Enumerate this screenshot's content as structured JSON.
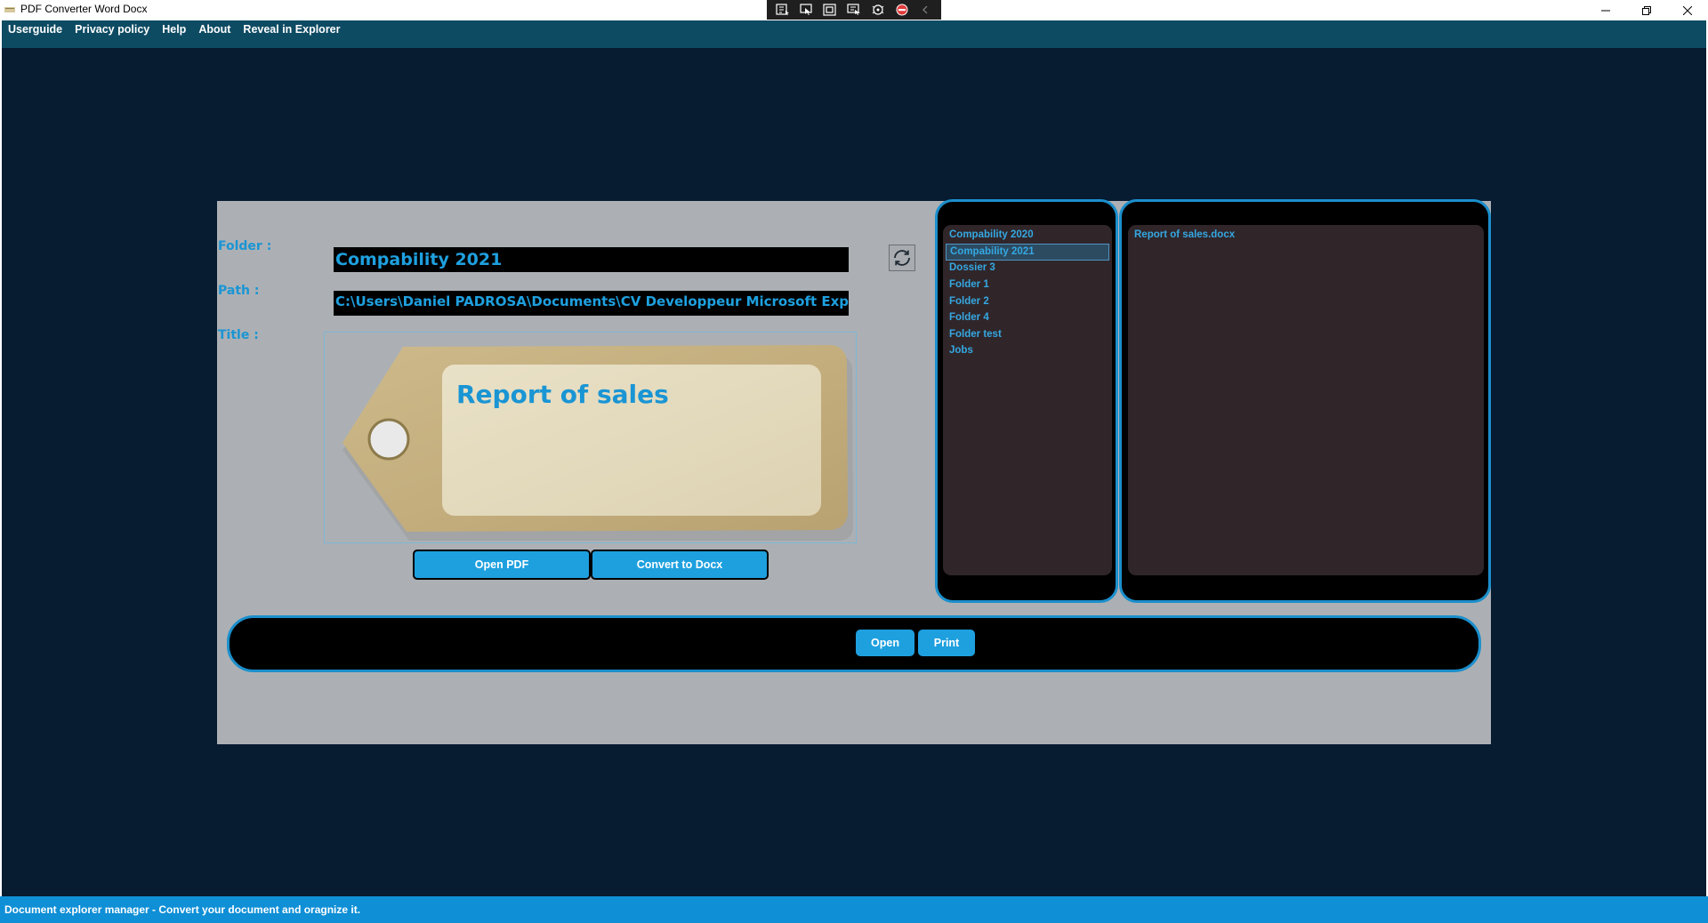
{
  "window": {
    "title": "PDF Converter Word Docx"
  },
  "debug_toolbar": {
    "icons": [
      "live-visual-tree-icon",
      "select-element-icon",
      "display-adorners-icon",
      "track-focus-icon",
      "hot-reload-icon",
      "stop-icon",
      "collapse-icon"
    ]
  },
  "menu": {
    "items": [
      "Userguide",
      "Privacy policy",
      "Help",
      "About",
      "Reveal in Explorer"
    ]
  },
  "form": {
    "folder_label": "Folder :",
    "path_label": "Path :",
    "title_label": "Title :",
    "folder_value": "Compability 2021",
    "path_value": "C:\\Users\\Daniel PADROSA\\Documents\\CV Developpeur Microsoft Experiment",
    "title_value": "Report of sales",
    "refresh_icon": "refresh-icon"
  },
  "buttons": {
    "open_pdf": "Open PDF",
    "convert_docx": "Convert to Docx",
    "open": "Open",
    "print": "Print"
  },
  "folders": {
    "items": [
      "Compability 2020",
      "Compability 2021",
      "Dossier 3",
      "Folder 1",
      "Folder 2",
      "Folder 4",
      "Folder test",
      "Jobs"
    ],
    "selected": "Compability 2021"
  },
  "files": {
    "items": [
      "Report of sales.docx"
    ]
  },
  "status": {
    "text": "Document explorer manager - Convert your document and oragnize it."
  },
  "colors": {
    "accent": "#1ea0df",
    "menubar": "#0d4b63",
    "background": "#071b31",
    "panel": "#acb0b4",
    "list_bg": "#30262a",
    "statusbar": "#0f8fd6"
  }
}
